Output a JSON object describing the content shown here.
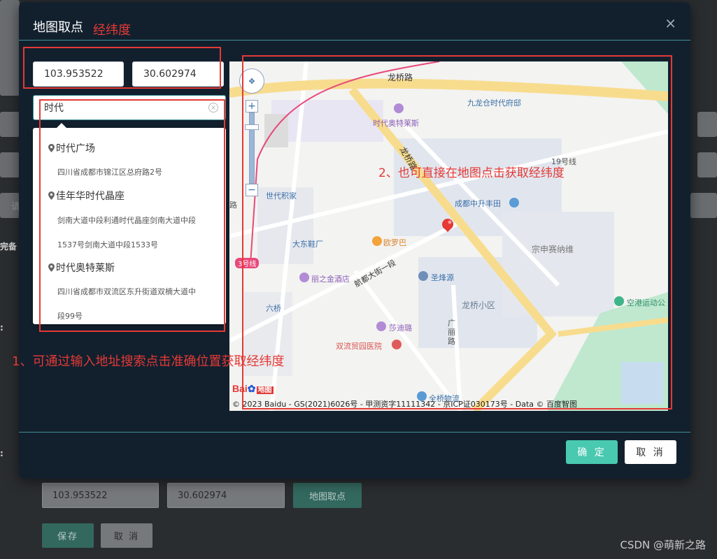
{
  "page": {
    "side_labels": [
      "完备",
      ":",
      ":"
    ],
    "placeholder_char": "请"
  },
  "form": {
    "lng_value": "103.953522",
    "lat_value": "30.602974",
    "pick_button": "地图取点",
    "save_button": "保存",
    "cancel_button": "取 消"
  },
  "watermark": "CSDN @萌新之路",
  "dialog": {
    "title": "地图取点",
    "close_symbol": "×",
    "lng_value": "103.953522",
    "lat_value": "30.602974",
    "search_value": "时代",
    "suggestions": [
      {
        "name": "时代广场",
        "address_lines": [
          "四川省成都市锦江区总府路2号"
        ]
      },
      {
        "name": "佳年华时代晶座",
        "address_lines": [
          "剑南大道中段利通时代晶座剑南大道中段",
          "1537号剑南大道中段1533号"
        ]
      },
      {
        "name": "时代奥特莱斯",
        "address_lines": [
          "四川省成都市双流区东升街道双楠大道中",
          "段99号"
        ]
      }
    ],
    "ok_button": "确 定",
    "cancel_button": "取 消"
  },
  "map": {
    "labels": {
      "longqiao_road_top": "龙桥路",
      "jiulongcang": "九龙仓时代府邸",
      "outlets": "时代奥特莱斯",
      "longqiao_road_diag": "龙桥路",
      "line19": "19号线",
      "shidaijijia": "世代积家",
      "zhongshengfeng": "成都中升丰田",
      "dadongxie": "大东鞋厂",
      "ouluoba": "欧罗巴",
      "zongshen": "宗申赛纳维",
      "line3": "3号线",
      "lizhijin": "丽之金酒店",
      "hangdu": "航都大街一段",
      "shengfengyuan": "圣烽源",
      "liuqiao": "六桥",
      "longqiao_area": "龙桥小区",
      "konggang": "空港运动公",
      "guangli": "广丽路",
      "shadilu": "莎迪璐",
      "hospital": "双流贸园医院",
      "wuliu": "全桥物流",
      "lu": "路"
    },
    "brand": "Bai",
    "brand_suffix": "地图",
    "copyright": "© 2023 Baidu - GS(2021)6026号 - 甲测资字11111342 - 京ICP证030173号 - Data © 百度智图",
    "colors": {
      "main_road": "#f8dc8e",
      "park": "#bfe8cf",
      "metro": "#e8487a",
      "water": "#c8dcf0"
    }
  },
  "annotations": {
    "header_note": "经纬度",
    "note_search": "1、可通过输入地址搜索点击准确位置获取经纬度",
    "note_map": "2、也可直接在地图点击获取经纬度",
    "color": "#e53935"
  }
}
